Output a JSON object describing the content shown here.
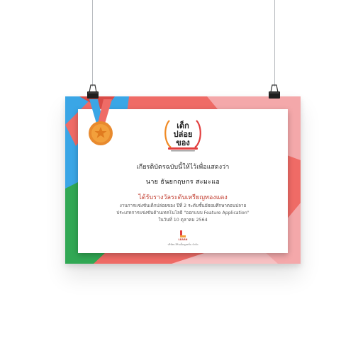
{
  "certificate": {
    "logo_text": "เด็กปล่อยของ",
    "intro": "เกียรติบัตรฉบับนี้ให้ไว้เพื่อแสดงว่า",
    "name": "นาย  ธันยกฤษกร  สะมะแอ",
    "award": "ได้รับรางวัลระดับเหรียญทองแดง",
    "detail_1": "งานการแข่งขันเด็กปล่อยของ ปีที่ 2 ระดับชั้นมัธยมศึกษาตอนปลาย",
    "detail_2": "ประเภทการแข่งขันด้านเทคโนโลยี \"ออกแบบ Feature Application\"",
    "date": "ในวันที่ 10 ตุลาคม 2564",
    "footer_brand": "LEARN",
    "footer_text": "บริษัท เลิร์นเอ็ดดูเคชั่น จำกัด"
  },
  "colors": {
    "coral": "#ef6b66",
    "pink": "#f4a8aa",
    "blue": "#3aa6e6",
    "green": "#31a854",
    "gold": "#f2a03c"
  },
  "icons": {
    "medal": "bronze-medal-icon",
    "clip": "binder-clip-icon"
  }
}
